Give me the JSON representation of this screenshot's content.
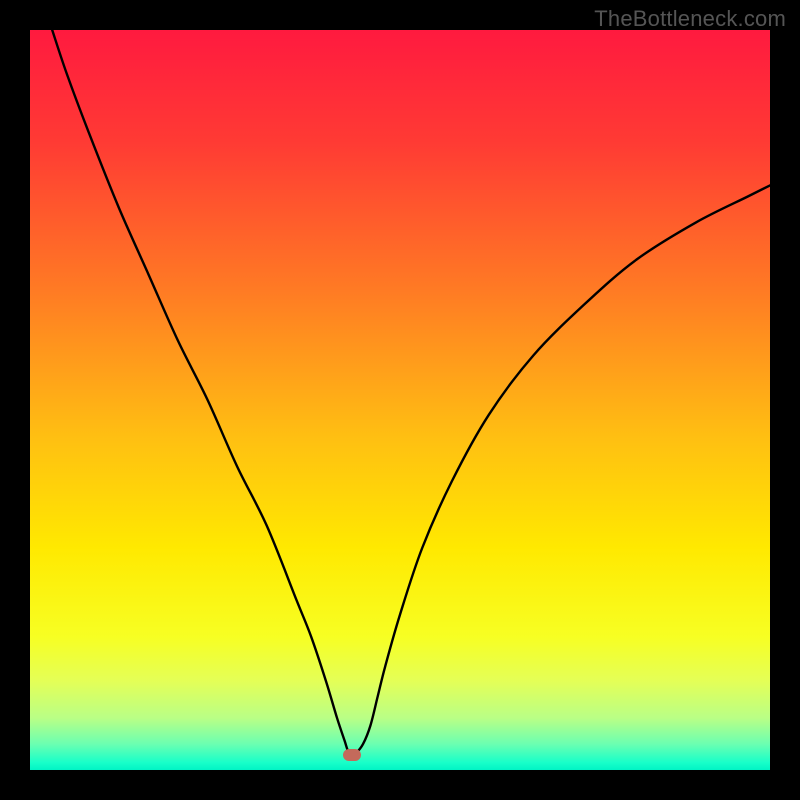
{
  "watermark": "TheBottleneck.com",
  "chart_data": {
    "type": "line",
    "title": "",
    "xlabel": "",
    "ylabel": "",
    "xlim": [
      0,
      100
    ],
    "ylim": [
      0,
      100
    ],
    "grid": false,
    "legend": false,
    "gradient_stops": [
      {
        "offset": 0.0,
        "color": "#ff1a3f"
      },
      {
        "offset": 0.15,
        "color": "#ff3a34"
      },
      {
        "offset": 0.35,
        "color": "#ff7a24"
      },
      {
        "offset": 0.55,
        "color": "#ffbf12"
      },
      {
        "offset": 0.7,
        "color": "#ffe900"
      },
      {
        "offset": 0.82,
        "color": "#f7ff23"
      },
      {
        "offset": 0.88,
        "color": "#e4ff57"
      },
      {
        "offset": 0.93,
        "color": "#b9ff86"
      },
      {
        "offset": 0.965,
        "color": "#6bffb1"
      },
      {
        "offset": 0.99,
        "color": "#18ffc9"
      },
      {
        "offset": 1.0,
        "color": "#00f4c5"
      }
    ],
    "series": [
      {
        "name": "bottleneck-curve",
        "color": "#000000",
        "x": [
          3,
          5,
          8,
          12,
          16,
          20,
          24,
          28,
          32,
          36,
          38,
          40,
          41.5,
          42.5,
          43,
          43.5,
          44,
          45,
          46,
          47,
          48,
          50,
          53,
          57,
          62,
          68,
          75,
          82,
          90,
          97,
          100
        ],
        "values": [
          100,
          94,
          86,
          76,
          67,
          58,
          50,
          41,
          33,
          23,
          18,
          12,
          7,
          4,
          2.5,
          2,
          2.2,
          3.5,
          6,
          10,
          14,
          21,
          30,
          39,
          48,
          56,
          63,
          69,
          74,
          77.5,
          79
        ]
      }
    ],
    "marker": {
      "x": 43.5,
      "y": 2.0,
      "color": "#c46a5b"
    }
  }
}
